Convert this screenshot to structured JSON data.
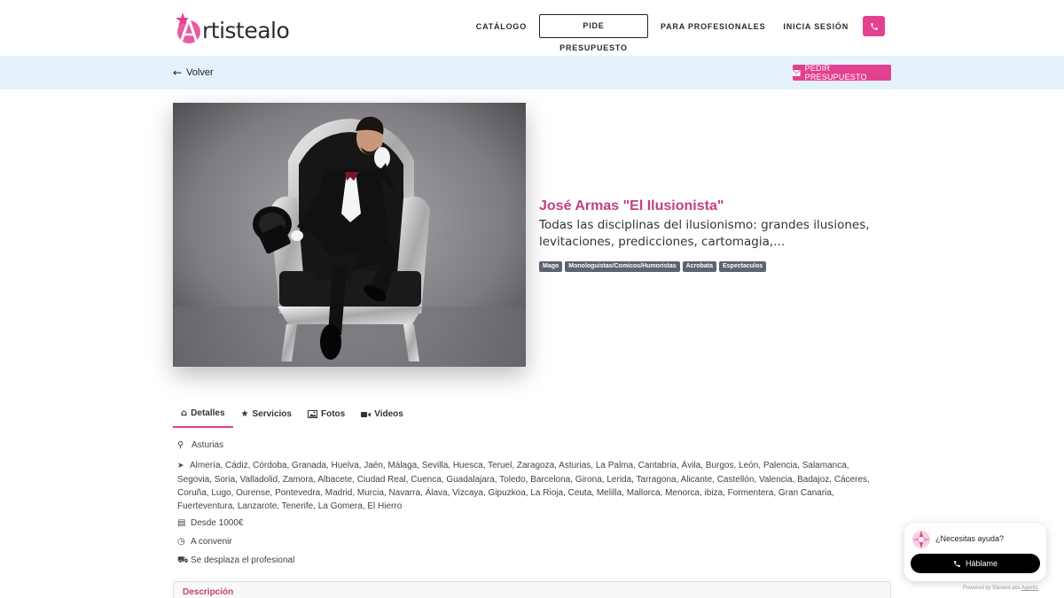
{
  "header": {
    "logo_text": "rtistealo",
    "nav": {
      "catalog": "CATÁLOGO",
      "quote": "PIDE PRESUPUESTO",
      "pros": "PARA PROFESIONALES",
      "login": "INICIA SESIÓN"
    }
  },
  "subbar": {
    "back": "Volver",
    "request": "PEDIR PRESUPUESTO"
  },
  "profile": {
    "name": "José Armas \"El Ilusionista\"",
    "description": "Todas las disciplinas del ilusionismo: grandes ilusiones, levitaciones, predicciones, cartomagia,...",
    "tags": [
      "Mago",
      "Monologuistas/Comicos/Humoristas",
      "Acrobata",
      "Espectaculos"
    ]
  },
  "tabs": [
    {
      "label": "Detalles",
      "icon": "home-icon"
    },
    {
      "label": "Servicios",
      "icon": "star-icon"
    },
    {
      "label": "Fotos",
      "icon": "image-icon"
    },
    {
      "label": "Videos",
      "icon": "video-icon"
    }
  ],
  "details": {
    "province": "Asturias",
    "zones": "Almería, Cádiz, Córdoba, Granada, Huelva, Jaén, Málaga, Sevilla, Huesca, Teruel, Zaragoza, Asturias, La Palma, Cantabria, Ávila, Burgos, León, Palencia, Salamanca, Segovia, Soria, Valladolid, Zamora, Albacete, Ciudad Real, Cuenca, Guadalajara, Toledo, Barcelona, Girona, Lerida, Tarragona, Alicante, Castellón, Valencia, Badajoz, Cáceres, Coruña, Lugo, Ourense, Pontevedra, Madrid, Murcia, Navarra, Álava, Vizcaya, Gipuzkoa, La Rioja, Ceuta, Melilla, Mallorca, Menorca, ibiza, Formentera, Gran Canaria, Fuerteventura, Lanzarote, Tenerife, La Gomera, El Hierro",
    "price": "Desde 1000€",
    "schedule": "A convenir",
    "travel": "Se desplaza el profesional"
  },
  "description_section": {
    "title": "Descripción"
  },
  "help_widget": {
    "question": "¿Necesitas ayuda?",
    "button": "Háblame",
    "powered_prefix": "Powered by ElevenLabs",
    "powered_link": "Agents"
  },
  "colors": {
    "accent": "#e3418f",
    "name": "#c2407f",
    "subbar_bg": "#e6f2fb",
    "tag_bg": "#5b6470"
  }
}
